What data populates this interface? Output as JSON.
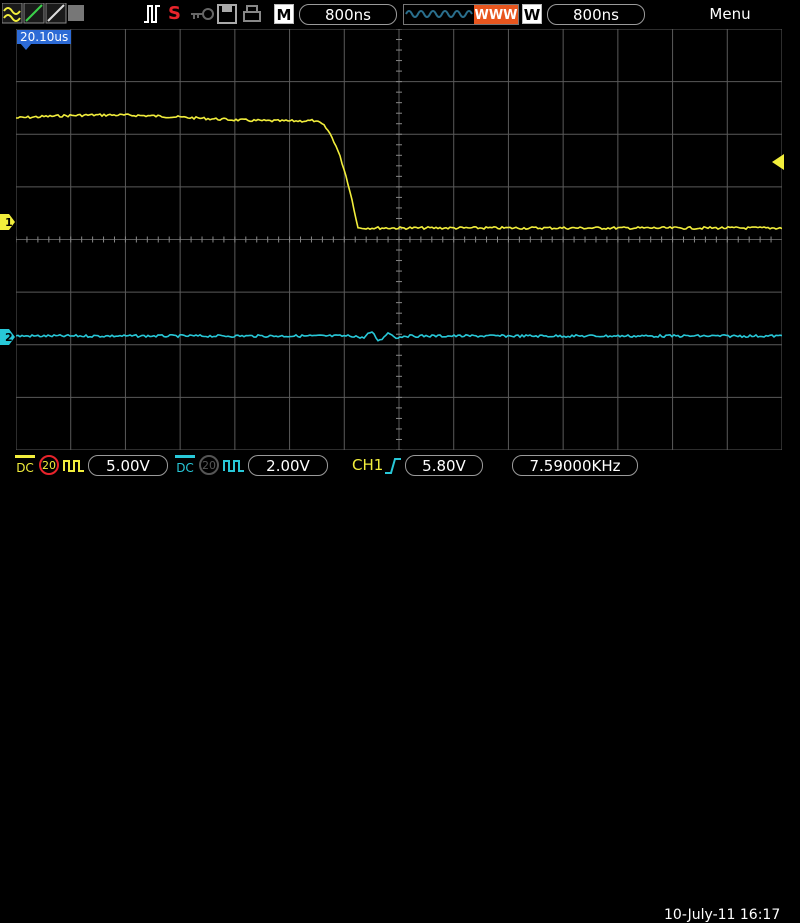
{
  "top_bar": {
    "mode_m": "M",
    "timebase": "800ns",
    "mode_w": "W",
    "window_timebase": "800ns",
    "menu": "Menu",
    "trigger_status": "S"
  },
  "waveform": {
    "trigger_position": "20.10us",
    "ch1_marker": "1",
    "ch2_marker": "2"
  },
  "bottom_bar": {
    "ch1_coupling": "DC",
    "ch1_bw": "20",
    "ch1_scale": "5.00V",
    "ch2_coupling": "DC",
    "ch2_bw": "20",
    "ch2_scale": "2.00V",
    "trigger_source": "CH1",
    "trigger_level": "5.80V",
    "frequency": "7.59000KHz",
    "datetime": "10-July-11 16:17"
  },
  "colors": {
    "ch1": "#f2ee3c",
    "ch2": "#28c8d8",
    "grid": "#5a5a5a",
    "accent_red": "#e8242b",
    "marker_blue": "#2d6bd6"
  }
}
